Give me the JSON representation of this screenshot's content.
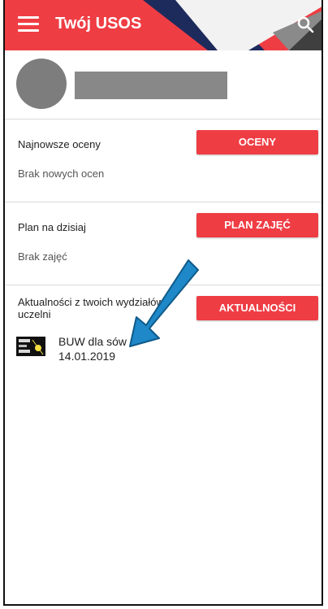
{
  "app": {
    "title": "Twój USOS"
  },
  "sections": {
    "grades": {
      "title": "Najnowsze oceny",
      "text": "Brak nowych ocen",
      "button": "OCENY"
    },
    "schedule": {
      "title": "Plan na dzisiaj",
      "text": "Brak zajęć",
      "button": "PLAN ZAJĘĆ"
    },
    "news": {
      "title": "Aktualności z twoich wydziałów i uczelni",
      "button": "AKTUALNOŚCI",
      "items": [
        {
          "title": "BUW dla sów",
          "date": "14.01.2019"
        }
      ]
    }
  },
  "colors": {
    "brand": "#ef3d44",
    "arrow": "#1e88c8",
    "avatar": "#7d7d7d"
  },
  "icons": {
    "menu": "hamburger-menu-icon",
    "search": "search-icon"
  }
}
